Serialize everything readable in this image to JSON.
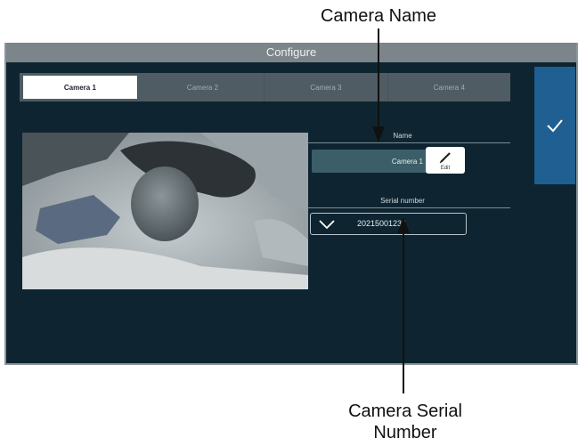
{
  "callouts": {
    "camera_name": "Camera Name",
    "camera_serial": "Camera Serial Number"
  },
  "window": {
    "title": "Configure"
  },
  "tabs": [
    {
      "label": "Camera 1",
      "active": true
    },
    {
      "label": "Camera 2",
      "active": false
    },
    {
      "label": "Camera 3",
      "active": false
    },
    {
      "label": "Camera 4",
      "active": false
    }
  ],
  "name_section": {
    "heading": "Name",
    "value": "Camera 1",
    "edit_label": "Edit"
  },
  "serial_section": {
    "heading": "Serial number",
    "value": "20215001234"
  },
  "icons": {
    "confirm": "checkmark-icon",
    "edit": "pencil-icon",
    "dropdown": "chevron-down-icon"
  },
  "colors": {
    "background": "#0e2531",
    "titlebar": "#7b858a",
    "confirm_button": "#1f5f91",
    "name_field": "#3b5e68"
  }
}
